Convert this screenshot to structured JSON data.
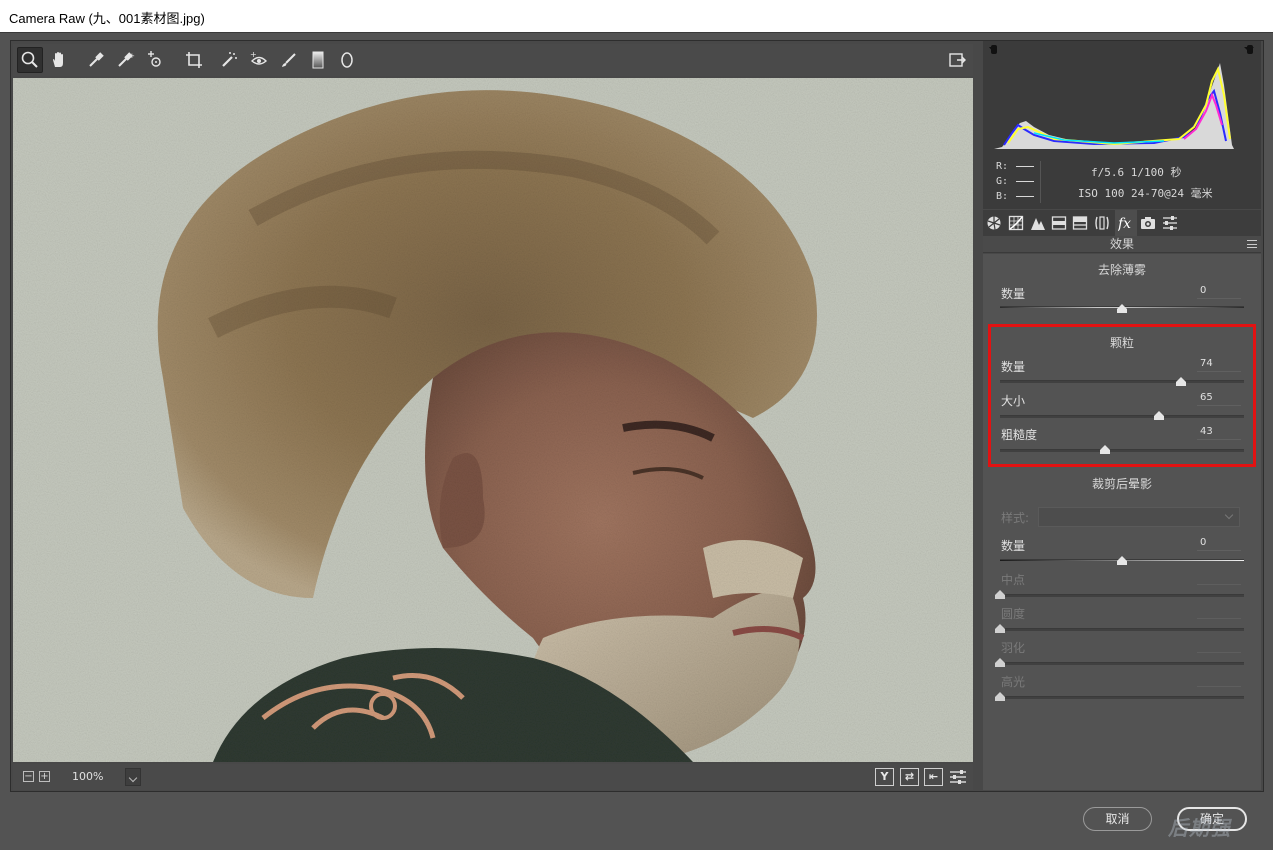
{
  "window": {
    "title": "Camera Raw (九、001素材图.jpg)"
  },
  "toolbar": {
    "tools": [
      "zoom-icon",
      "hand-icon",
      "white-balance-icon",
      "color-sampler-icon",
      "targeted-adjust-icon",
      "crop-icon",
      "spot-removal-icon",
      "red-eye-icon",
      "adjustment-brush-icon",
      "graduated-filter-icon",
      "radial-filter-icon"
    ],
    "active_tool": "zoom-icon"
  },
  "info": {
    "r_label": "R:",
    "g_label": "G:",
    "b_label": "B:",
    "exposure": "f/5.6  1/100 秒",
    "lens": "ISO 100  24-70@24 毫米"
  },
  "panel": {
    "title": "效果",
    "dehaze": {
      "title": "去除薄雾",
      "amount_label": "数量",
      "amount_value": "0",
      "amount": 0
    },
    "grain": {
      "title": "颗粒",
      "amount_label": "数量",
      "amount_value": "74",
      "amount": 74,
      "size_label": "大小",
      "size_value": "65",
      "size": 65,
      "roughness_label": "粗糙度",
      "roughness_value": "43",
      "roughness": 43
    },
    "vignette": {
      "title": "裁剪后晕影",
      "style_label": "样式:",
      "amount_label": "数量",
      "amount_value": "0",
      "amount": 0,
      "midpoint_label": "中点",
      "roundness_label": "圆度",
      "feather_label": "羽化",
      "highlights_label": "高光"
    }
  },
  "statusbar": {
    "zoom": "100%",
    "minus": "−",
    "plus": "+",
    "view_y": "Y",
    "view_toggle": "⇄",
    "view_swap": "⇤"
  },
  "footer": {
    "cancel_label": "取消",
    "ok_label": "确定"
  },
  "watermark": "后期强"
}
